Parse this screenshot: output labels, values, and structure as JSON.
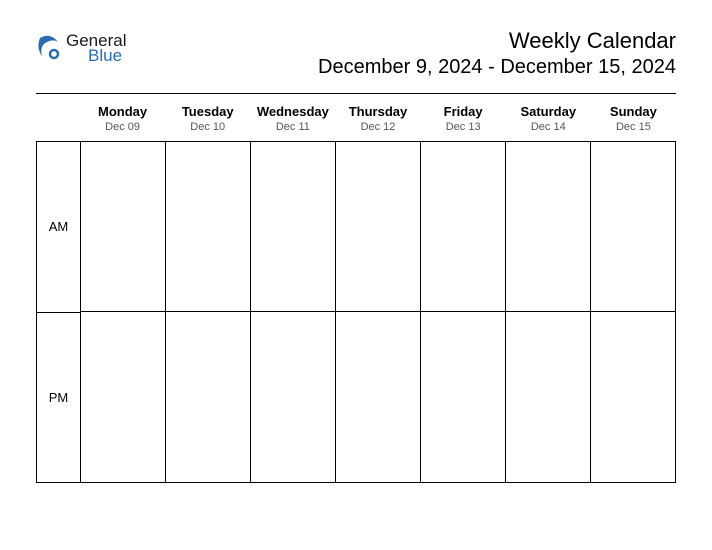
{
  "logo": {
    "line1": "General",
    "line2": "Blue"
  },
  "header": {
    "title": "Weekly Calendar",
    "date_range": "December 9, 2024 - December 15, 2024"
  },
  "rows": {
    "am": "AM",
    "pm": "PM"
  },
  "days": [
    {
      "name": "Monday",
      "date": "Dec 09"
    },
    {
      "name": "Tuesday",
      "date": "Dec 10"
    },
    {
      "name": "Wednesday",
      "date": "Dec 11"
    },
    {
      "name": "Thursday",
      "date": "Dec 12"
    },
    {
      "name": "Friday",
      "date": "Dec 13"
    },
    {
      "name": "Saturday",
      "date": "Dec 14"
    },
    {
      "name": "Sunday",
      "date": "Dec 15"
    }
  ]
}
